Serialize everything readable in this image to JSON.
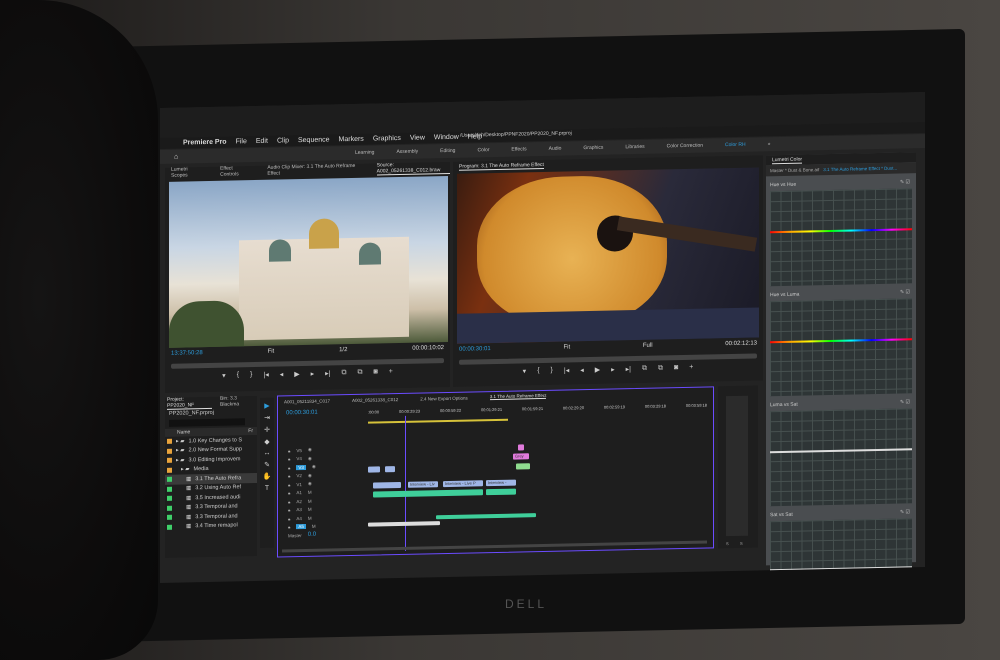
{
  "menu": {
    "app": "Premiere Pro",
    "items": [
      "File",
      "Edit",
      "Clip",
      "Sequence",
      "Markers",
      "Graphics",
      "View",
      "Window",
      "Help"
    ]
  },
  "path": "/Users/rich/Desktop/PPNF2020/PP2020_NF.prproj",
  "workspaces": [
    "Learning",
    "Assembly",
    "Editing",
    "Color",
    "Effects",
    "Audio",
    "Graphics",
    "Libraries",
    "Color Correction",
    "Color RH"
  ],
  "workspace_active": "Color RH",
  "source_panel": {
    "tabs": [
      "Lumetri Scopes",
      "Effect Controls",
      "Audio Clip Mixer: 3.1 The Auto Reframe Effect",
      "Source: A002_05261338_C012.braw"
    ],
    "timecode": "13:37:50:28",
    "fit": "Fit",
    "resolution": "1/2",
    "duration": "00:00:10:02"
  },
  "program_panel": {
    "title": "Program: 3.1 The Auto Reframe Effect",
    "timecode": "00:00:30:01",
    "fit": "Fit",
    "resolution": "Full",
    "duration": "00:02:12:13"
  },
  "transport": [
    "▾",
    "{",
    "}",
    "|◂",
    "◂",
    "▶",
    "▸",
    "▸|",
    "⧉",
    "⧉",
    "◙",
    "+"
  ],
  "project": {
    "tabs": [
      "Project: PP2020_NF",
      "Bin: 3.3 Blackma"
    ],
    "file": "PP2020_NF.prproj",
    "column": "Name",
    "column2": "Fr",
    "items": [
      {
        "label": "1.0 Key Changes to S",
        "color": "#e8a33c",
        "indent": 1,
        "type": "folder"
      },
      {
        "label": "2.0 New Format Supp",
        "color": "#e8a33c",
        "indent": 1,
        "type": "folder"
      },
      {
        "label": "3.0 Editing Improvem",
        "color": "#e8a33c",
        "indent": 1,
        "type": "folder"
      },
      {
        "label": "Media",
        "color": "#e8a33c",
        "indent": 2,
        "type": "folder"
      },
      {
        "label": "3.1 The Auto Refra",
        "color": "#3fcf6a",
        "indent": 3,
        "type": "seq"
      },
      {
        "label": "3.2 Using Auto Ref",
        "color": "#3fcf6a",
        "indent": 3,
        "type": "seq"
      },
      {
        "label": "3.5 Increased audi",
        "color": "#3fcf6a",
        "indent": 3,
        "type": "seq"
      },
      {
        "label": "3.3  Temporal and",
        "color": "#3fcf6a",
        "indent": 3,
        "type": "seq"
      },
      {
        "label": "3.3  Temporal and",
        "color": "#3fcf6a",
        "indent": 3,
        "type": "seq"
      },
      {
        "label": "3.4 Time remapol",
        "color": "#3fcf6a",
        "indent": 3,
        "type": "seq"
      }
    ]
  },
  "timeline": {
    "tabs": [
      "A001_05211834_C017",
      "A002_05261338_C012",
      "2.4 New Export Options",
      "3.1 The Auto Reframe Effect"
    ],
    "timecode": "00:00:30:01",
    "ruler": [
      ":00:00",
      "00:00:29:23",
      "00:00:59:22",
      "00:01:29:21",
      "00:01:59:21",
      "00:02:29:20",
      "00:02:59:19",
      "00:03:29:18",
      "00:03:59:18"
    ],
    "tracks": [
      "V5",
      "V4",
      "V3",
      "V2",
      "V1",
      "A1",
      "A2",
      "A3",
      "A4",
      "A5"
    ],
    "master": "Master",
    "master_val": "0.0",
    "clip_labels": [
      "Interview - Liv",
      "Interview - Live P",
      "Interview -",
      "Grey"
    ]
  },
  "meters": {
    "labels": [
      "S",
      "S"
    ]
  },
  "lumetri": {
    "title": "Lumetri Color",
    "master": "Master * Dust & Bone.aif",
    "clip": "3.1 The Auto Reframe Effect * Dust...",
    "curves": [
      "Hue vs Hue",
      "Hue vs Luma",
      "Luma vs Sat",
      "Sat vs Sat"
    ]
  },
  "bezel_brand": "DELL",
  "colors": {
    "accent": "#2d9cdb",
    "timeline_border": "#6b4cff"
  }
}
